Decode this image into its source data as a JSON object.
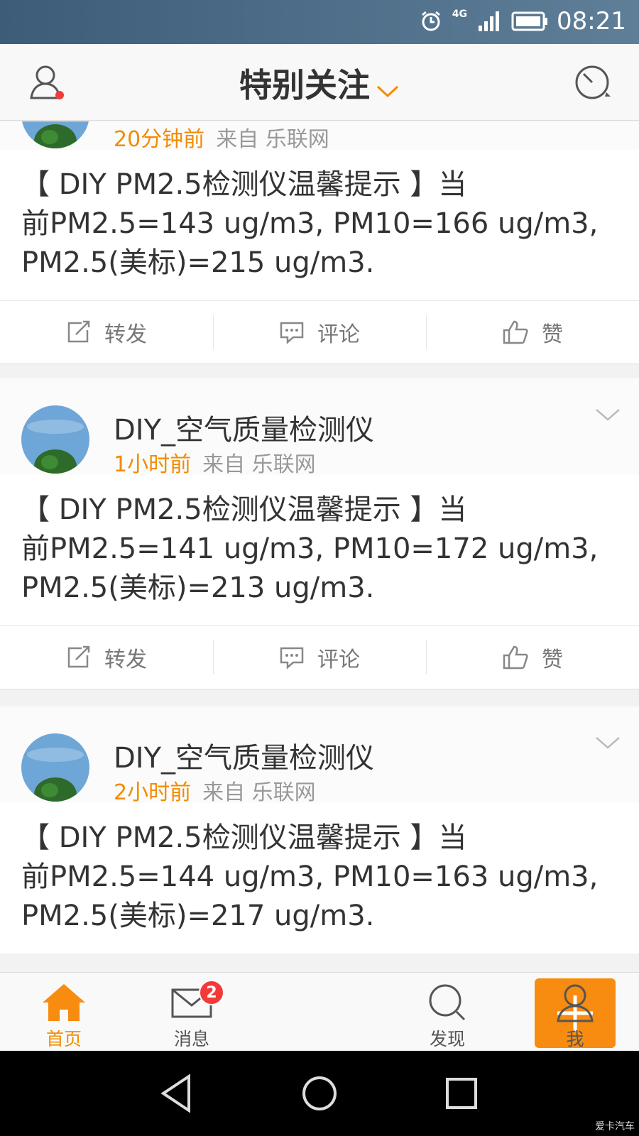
{
  "status_bar": {
    "time": "08:21",
    "network": "4G",
    "icons": [
      "alarm-icon",
      "signal-icon",
      "battery-icon"
    ]
  },
  "header": {
    "title": "特别关注",
    "left_icon": "profile-icon",
    "right_icon": "radar-icon",
    "accent": "#f28b00"
  },
  "posts": [
    {
      "author": "",
      "time": "20分钟前",
      "source": "来自 乐联网",
      "text_lines": [
        "【 DIY PM2.5检测仪温馨提示 】当",
        "前PM2.5=143 ug/m3, PM10=166 ug/m3,",
        "PM2.5(美标)=215 ug/m3."
      ],
      "actions": {
        "repost": "转发",
        "comment": "评论",
        "like": "赞"
      }
    },
    {
      "author": "DIY_空气质量检测仪",
      "time": "1小时前",
      "source": "来自 乐联网",
      "text_lines": [
        "【 DIY PM2.5检测仪温馨提示 】当",
        "前PM2.5=141 ug/m3, PM10=172 ug/m3,",
        "PM2.5(美标)=213 ug/m3."
      ],
      "actions": {
        "repost": "转发",
        "comment": "评论",
        "like": "赞"
      }
    },
    {
      "author": "DIY_空气质量检测仪",
      "time": "2小时前",
      "source": "来自 乐联网",
      "text_lines": [
        "【 DIY PM2.5检测仪温馨提示 】当",
        "前PM2.5=144 ug/m3, PM10=163 ug/m3,",
        "PM2.5(美标)=217 ug/m3."
      ]
    }
  ],
  "tabbar": {
    "tabs": [
      {
        "label": "首页",
        "icon": "home-icon",
        "active": true
      },
      {
        "label": "消息",
        "icon": "mail-icon",
        "badge": "2"
      },
      {
        "label": "",
        "icon": "plus-icon"
      },
      {
        "label": "发现",
        "icon": "search-icon"
      },
      {
        "label": "我",
        "icon": "person-icon"
      }
    ]
  },
  "watermark": "爱卡汽车"
}
